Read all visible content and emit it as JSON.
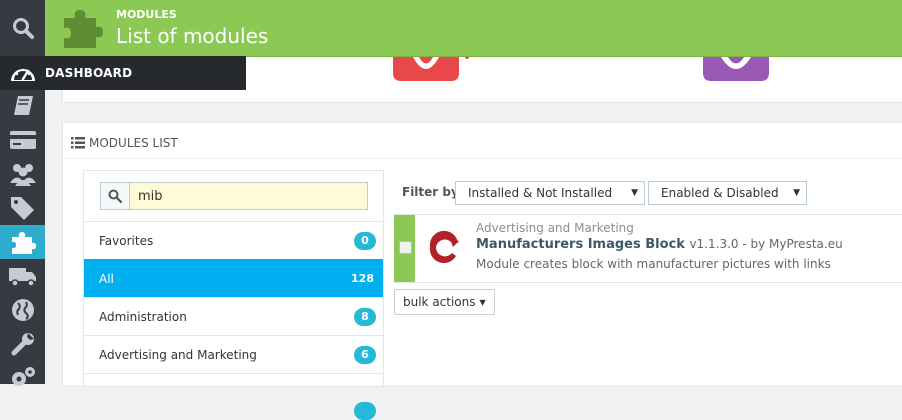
{
  "header": {
    "breadcrumb": "MODULES",
    "title": "List of modules",
    "color": "#8bc954"
  },
  "sidebar": {
    "items": [
      {
        "icon": "search-icon"
      },
      {
        "icon": "dashboard-icon",
        "label": "DASHBOARD"
      },
      {
        "icon": "orders-icon"
      },
      {
        "icon": "credit-card-icon"
      },
      {
        "icon": "customers-icon"
      },
      {
        "icon": "tags-icon"
      },
      {
        "icon": "puzzle-icon",
        "active": true
      },
      {
        "icon": "truck-icon"
      },
      {
        "icon": "globe-icon"
      },
      {
        "icon": "wrench-icon"
      },
      {
        "icon": "cogs-icon"
      }
    ]
  },
  "modules_list": {
    "heading": "MODULES LIST",
    "search": {
      "value": "mib",
      "placeholder": ""
    },
    "categories": [
      {
        "label": "Favorites",
        "count": "0"
      },
      {
        "label": "All",
        "count": "128",
        "active": true
      },
      {
        "label": "Administration",
        "count": "8"
      },
      {
        "label": "Advertising and Marketing",
        "count": "6"
      }
    ],
    "filter": {
      "label": "Filter by",
      "install_status": "Installed & Not Installed",
      "enabled_status": "Enabled & Disabled"
    },
    "module": {
      "category": "Advertising and Marketing",
      "name": "Manufacturers Images Block",
      "version": "v1.1.3.0 - by MyPresta.eu",
      "description": "Module creates block with manufacturer pictures with links"
    },
    "bulk_actions": "bulk actions"
  },
  "colors": {
    "accent": "#00aff0",
    "badge": "#25b9d7",
    "sidebar": "#363a41"
  }
}
